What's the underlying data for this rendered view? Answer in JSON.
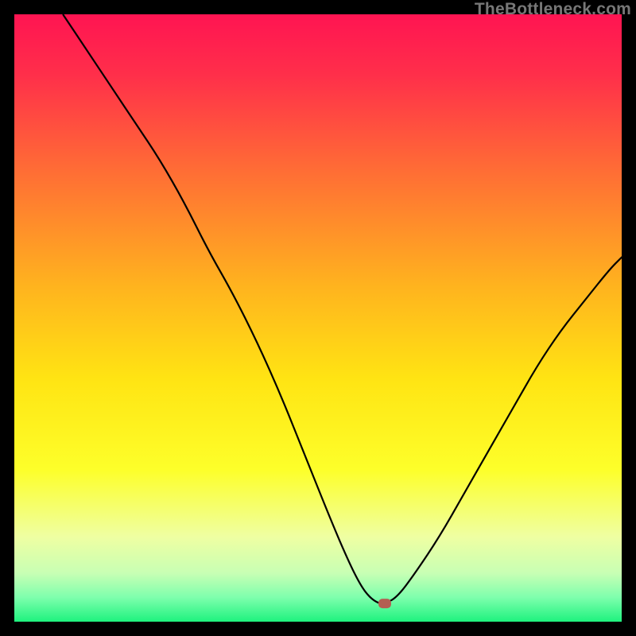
{
  "watermark": "TheBottleneck.com",
  "colors": {
    "frame": "#000000",
    "curve": "#000000",
    "marker": "#b35f52",
    "gradient_stops": [
      {
        "offset": 0.0,
        "color": "#ff1452"
      },
      {
        "offset": 0.1,
        "color": "#ff2f4a"
      },
      {
        "offset": 0.25,
        "color": "#ff6a36"
      },
      {
        "offset": 0.45,
        "color": "#ffb41e"
      },
      {
        "offset": 0.6,
        "color": "#ffe413"
      },
      {
        "offset": 0.75,
        "color": "#fdff2a"
      },
      {
        "offset": 0.86,
        "color": "#efffa2"
      },
      {
        "offset": 0.92,
        "color": "#c8ffb4"
      },
      {
        "offset": 0.96,
        "color": "#7effad"
      },
      {
        "offset": 1.0,
        "color": "#1ef27e"
      }
    ]
  },
  "chart_data": {
    "type": "line",
    "title": "",
    "xlabel": "",
    "ylabel": "",
    "xlim": [
      0,
      100
    ],
    "ylim": [
      0,
      100
    ],
    "marker": {
      "x": 61,
      "y": 3
    },
    "series": [
      {
        "name": "bottleneck-curve",
        "x": [
          8,
          12,
          16,
          20,
          24,
          28,
          32,
          36,
          40,
          44,
          48,
          52,
          55,
          57,
          58.5,
          60,
          61,
          63,
          66,
          70,
          74,
          78,
          82,
          86,
          90,
          94,
          98,
          100
        ],
        "y": [
          100,
          94,
          88,
          82,
          76,
          69,
          61,
          54,
          46,
          37,
          27,
          17,
          10,
          6,
          4,
          3,
          3,
          4,
          8,
          14,
          21,
          28,
          35,
          42,
          48,
          53,
          58,
          60
        ]
      }
    ],
    "notes": "x and y are approximate percentages read from the image; y is distance from the bottom (0 = bottom edge, 100 = top edge)."
  }
}
